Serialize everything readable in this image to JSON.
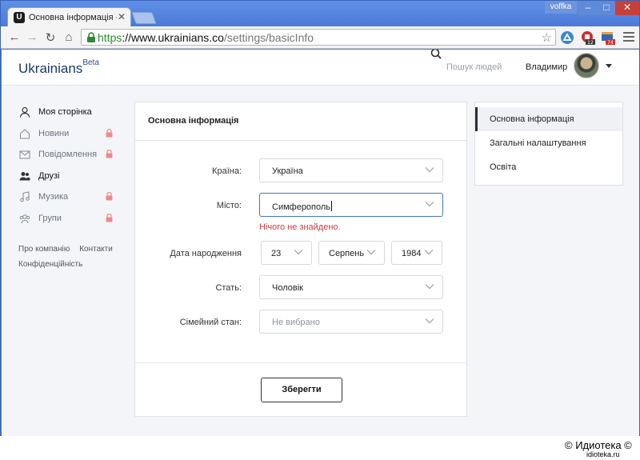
{
  "browser": {
    "tab_title": "Основна інформація - Ukrai",
    "favicon_letter": "U",
    "profile_name": "voffka",
    "url_scheme": "https",
    "url_host": "://www.ukrainians.co",
    "url_path": "/settings/basicInfo",
    "ext_badge_1": "12",
    "ext_badge_2": "74"
  },
  "header": {
    "logo": "Ukrainians",
    "logo_sup": "Beta",
    "people_search": "Пошук людей",
    "username": "Владимир"
  },
  "sidenav": {
    "items": [
      {
        "label": "Моя сторінка"
      },
      {
        "label": "Новини"
      },
      {
        "label": "Повідомлення"
      },
      {
        "label": "Друзі"
      },
      {
        "label": "Музика"
      },
      {
        "label": "Групи"
      }
    ],
    "footer": {
      "about": "Про компанію",
      "contacts": "Контакти",
      "privacy": "Конфіденційність"
    }
  },
  "form": {
    "title": "Основна інформація",
    "country": {
      "label": "Країна:",
      "value": "Україна"
    },
    "city": {
      "label": "Місто:",
      "value": "Симферополь",
      "error": "Нічого не знайдено."
    },
    "birthdate": {
      "label": "Дата народження",
      "day": "23",
      "month": "Серпень",
      "year": "1984"
    },
    "gender": {
      "label": "Стать:",
      "value": "Чоловік"
    },
    "marital": {
      "label": "Сімейний стан:",
      "value": "Не вибрано"
    },
    "save_label": "Зберегти"
  },
  "settings_menu": {
    "items": [
      {
        "label": "Основна інформація"
      },
      {
        "label": "Загальні налаштування"
      },
      {
        "label": "Освіта"
      }
    ]
  },
  "watermark": {
    "text": "© Идиотека ©",
    "url": "idioteka.ru"
  }
}
